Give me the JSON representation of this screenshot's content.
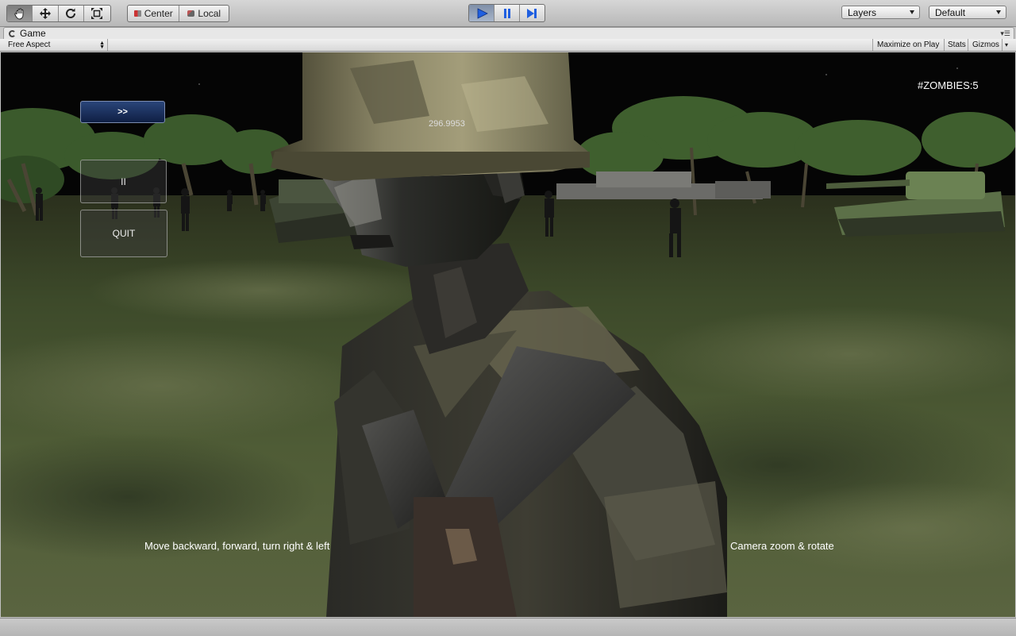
{
  "toolbar": {
    "pivot_label": "Center",
    "space_label": "Local",
    "layers_label": "Layers",
    "layout_label": "Default"
  },
  "window": {
    "tab_title": "Game",
    "aspect_label": "Free Aspect",
    "maximize_label": "Maximize on Play",
    "stats_label": "Stats",
    "gizmos_label": "Gizmos"
  },
  "game": {
    "next_button": ">>",
    "pause_button": "II",
    "quit_button": "QUIT",
    "zombie_counter": "#ZOMBIES:5",
    "coordinate_readout": "296.9953",
    "hint_left": "Move backward, forward, turn right & left",
    "hint_right": "Camera zoom & rotate"
  },
  "colors": {
    "play_active": "#3a6fd8",
    "sky": "#050505",
    "ground": "#4d5a34"
  }
}
